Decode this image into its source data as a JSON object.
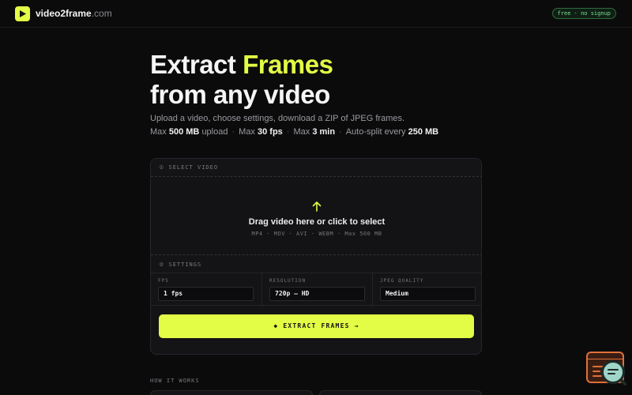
{
  "header": {
    "brand": "video2frame",
    "brand_domain": ".com",
    "badge": "free · no signup",
    "icon": "play-icon"
  },
  "hero": {
    "title_part1": "Extract",
    "title_accent": "Frames",
    "title_line2": "from any video",
    "subtitle": "Upload a video, choose settings, download a ZIP of JPEG frames.",
    "limits": [
      {
        "prefix": "Max",
        "value": "500 MB",
        "suffix": "upload"
      },
      {
        "prefix": "Max",
        "value": "30 fps",
        "suffix": ""
      },
      {
        "prefix": "Max",
        "value": "3 min",
        "suffix": ""
      },
      {
        "prefix": "Auto-split every",
        "value": "250 MB",
        "suffix": ""
      }
    ]
  },
  "upload": {
    "section_label": "① SELECT VIDEO",
    "drop_title": "Drag video here or click to select",
    "drop_formats": "MP4 · MOV · AVI · WEBM · Max 500 MB",
    "icon": "upload-arrow-icon"
  },
  "settings": {
    "section_label": "② SETTINGS",
    "fps": {
      "label": "FPS",
      "value": "1 fps"
    },
    "resolution": {
      "label": "RESOLUTION",
      "value": "720p — HD"
    },
    "quality": {
      "label": "JPEG QUALITY",
      "value": "Medium"
    }
  },
  "action": {
    "extract_label": "◆ EXTRACT FRAMES →"
  },
  "how": {
    "label": "HOW IT WORKS"
  },
  "colors": {
    "accent": "#e3fc45",
    "background": "#0b0b0c",
    "badge_green": "#76e08f"
  }
}
